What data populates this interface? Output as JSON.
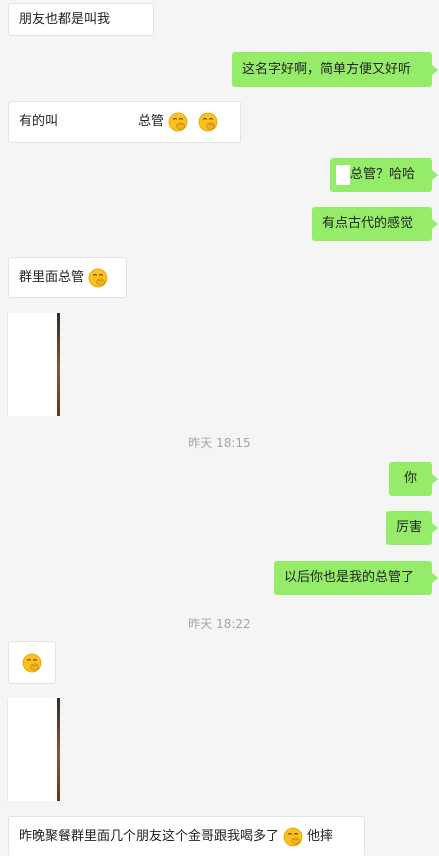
{
  "colors": {
    "background": "#f5f5f5",
    "incoming_bubble": "#ffffff",
    "outgoing_bubble": "#95ec69",
    "timestamp_text": "#a5a5a5"
  },
  "messages": [
    {
      "side": "in",
      "text": "朋友也都是叫我"
    },
    {
      "side": "out",
      "text": "这名字好啊，简单方便又好听"
    },
    {
      "side": "in",
      "text_before": "有的叫",
      "text_after": "总管",
      "emojis": [
        "face-with-hand-over-mouth-icon",
        "face-with-hand-over-mouth-icon"
      ]
    },
    {
      "side": "out",
      "text": "总管？哈哈"
    },
    {
      "side": "out",
      "text": "有点古代的感觉"
    },
    {
      "side": "in",
      "text": "群里面总管",
      "emojis": [
        "face-with-hand-over-mouth-icon"
      ]
    },
    {
      "side": "in",
      "type": "image"
    },
    {
      "side": "out",
      "text": "你"
    },
    {
      "side": "out",
      "text": "厉害"
    },
    {
      "side": "out",
      "text": "以后你也是我的总管了"
    },
    {
      "side": "in",
      "emojis": [
        "face-with-hand-over-mouth-icon"
      ]
    },
    {
      "side": "in",
      "type": "image"
    },
    {
      "side": "in",
      "text_before": "昨晚聚餐群里面几个朋友这个金哥跟我喝多了",
      "text_after": "他摔",
      "emojis": [
        "face-with-hand-over-mouth-icon"
      ]
    }
  ],
  "timestamps": [
    "昨天 18:15",
    "昨天 18:22"
  ]
}
